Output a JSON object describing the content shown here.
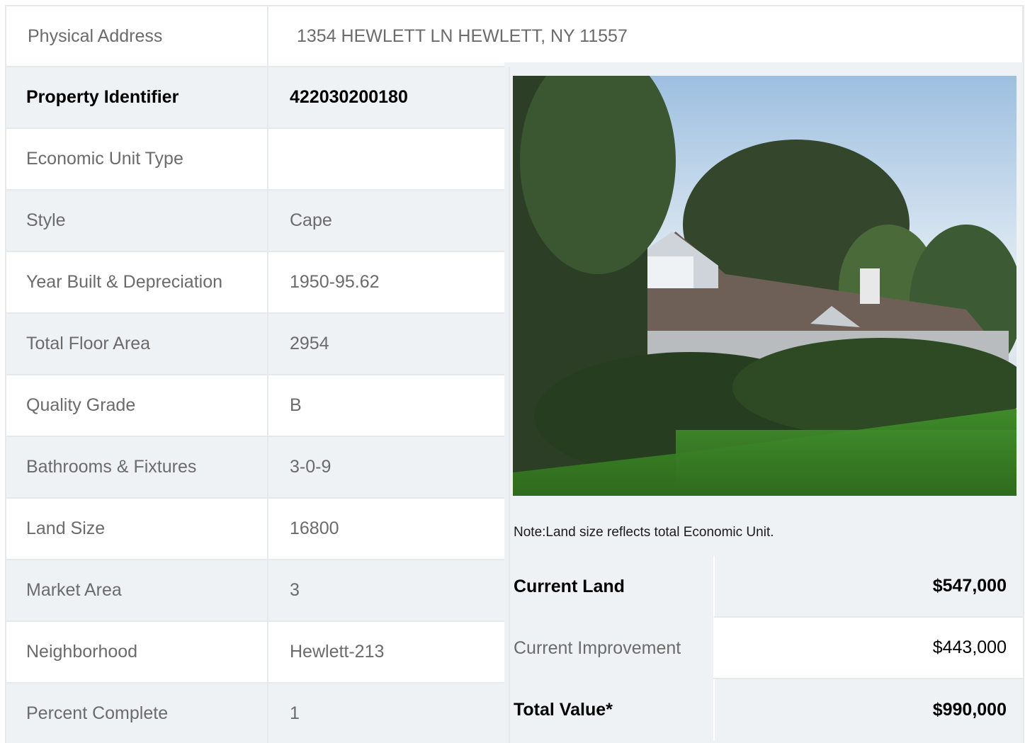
{
  "address": {
    "label": "Physical Address",
    "value": "1354  HEWLETT LN  HEWLETT, NY  11557"
  },
  "rows": [
    {
      "label": "Property Identifier",
      "value": "422030200180"
    },
    {
      "label": "Economic Unit Type",
      "value": ""
    },
    {
      "label": "Style",
      "value": "Cape"
    },
    {
      "label": "Year Built & Depreciation",
      "value": "1950-95.62"
    },
    {
      "label": "Total Floor Area",
      "value": "2954"
    },
    {
      "label": "Quality Grade",
      "value": "B"
    },
    {
      "label": "Bathrooms & Fixtures",
      "value": "3-0-9"
    },
    {
      "label": "Land Size",
      "value": "16800"
    },
    {
      "label": "Market Area",
      "value": "3"
    },
    {
      "label": "Neighborhood",
      "value": "Hewlett-213"
    },
    {
      "label": "Percent Complete",
      "value": "1"
    }
  ],
  "note": "Note:Land size reflects total Economic Unit.",
  "values": {
    "land": {
      "label": "Current Land",
      "value": "$547,000"
    },
    "improvement": {
      "label": "Current Improvement",
      "value": "$443,000"
    },
    "total": {
      "label": "Total Value*",
      "value": "$990,000"
    }
  }
}
